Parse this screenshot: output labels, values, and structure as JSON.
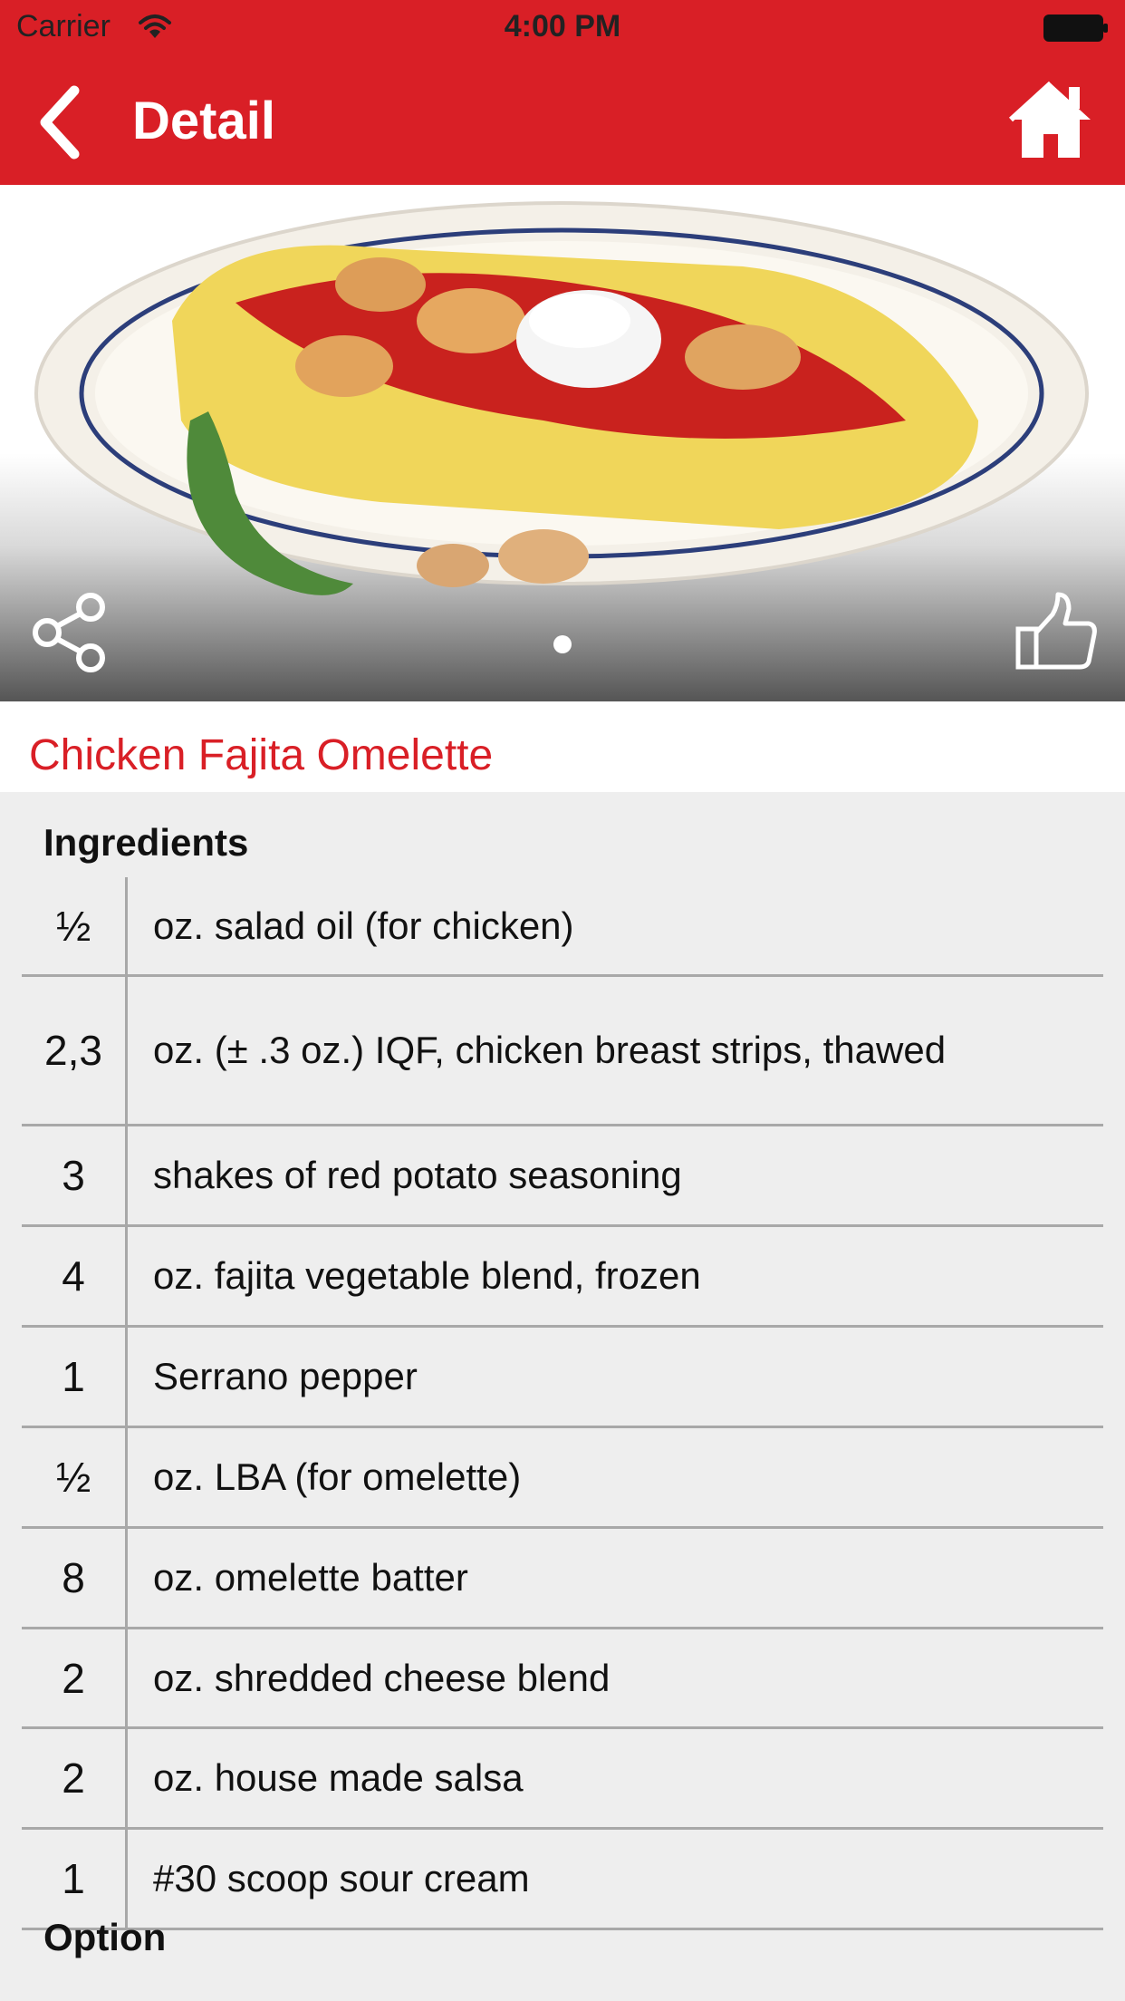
{
  "status_bar": {
    "carrier": "Carrier",
    "time": "4:00 PM"
  },
  "nav": {
    "back_icon": "chevron-left-icon",
    "title": "Detail",
    "home_icon": "home-icon"
  },
  "hero": {
    "image": "chicken-fajita-omelette-photo",
    "share_icon": "share-icon",
    "like_icon": "thumbs-up-icon",
    "page_index": 1,
    "page_count": 1
  },
  "recipe": {
    "title": "Chicken Fajita Omelette"
  },
  "ingredients": {
    "heading": "Ingredients",
    "items": [
      {
        "qty": "½",
        "desc": "oz. salad oil (for chicken)"
      },
      {
        "qty": "2,3",
        "desc": "oz. (± .3 oz.) IQF, chicken breast strips, thawed"
      },
      {
        "qty": "3",
        "desc": "shakes of red potato seasoning"
      },
      {
        "qty": "4",
        "desc": "oz. fajita vegetable blend, frozen"
      },
      {
        "qty": "1",
        "desc": "Serrano pepper"
      },
      {
        "qty": "½",
        "desc": "oz. LBA (for omelette)"
      },
      {
        "qty": "8",
        "desc": "oz. omelette batter"
      },
      {
        "qty": "2",
        "desc": "oz. shredded cheese blend"
      },
      {
        "qty": "2",
        "desc": "oz. house made salsa"
      },
      {
        "qty": "1",
        "desc": "#30 scoop sour cream"
      }
    ]
  },
  "option": {
    "heading": "Option"
  },
  "colors": {
    "brand_red": "#d91f26",
    "table_bg": "#eeeeee",
    "divider": "#a8a8a8"
  }
}
